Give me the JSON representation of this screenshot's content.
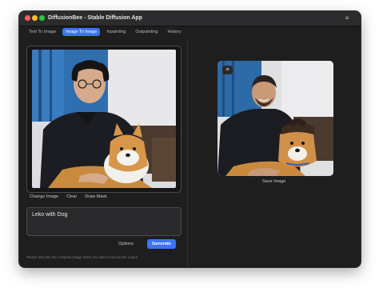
{
  "app": {
    "title": "DiffusionBee - Stable Diffusion App",
    "menu_icon": "hamburger-icon"
  },
  "tabs": [
    {
      "label": "Text To Image",
      "active": false
    },
    {
      "label": "Image To Image",
      "active": true
    },
    {
      "label": "Inpainting",
      "active": false
    },
    {
      "label": "Outpainting",
      "active": false
    },
    {
      "label": "History",
      "active": false
    }
  ],
  "input_panel": {
    "actions": {
      "change_image": "Change Image",
      "clear": "Clear",
      "draw_mask": "Draw Mask"
    }
  },
  "prompt": {
    "value": "Leko with Dog",
    "hint": "Please describe the complete image which you want to see as the output.",
    "options_label": "Options",
    "generate_label": "Generate"
  },
  "output_panel": {
    "save_label": "Save Image",
    "menu_icon": "hamburger-icon"
  },
  "colors": {
    "accent": "#3d74f6",
    "window_bg": "#1e1e1f"
  }
}
